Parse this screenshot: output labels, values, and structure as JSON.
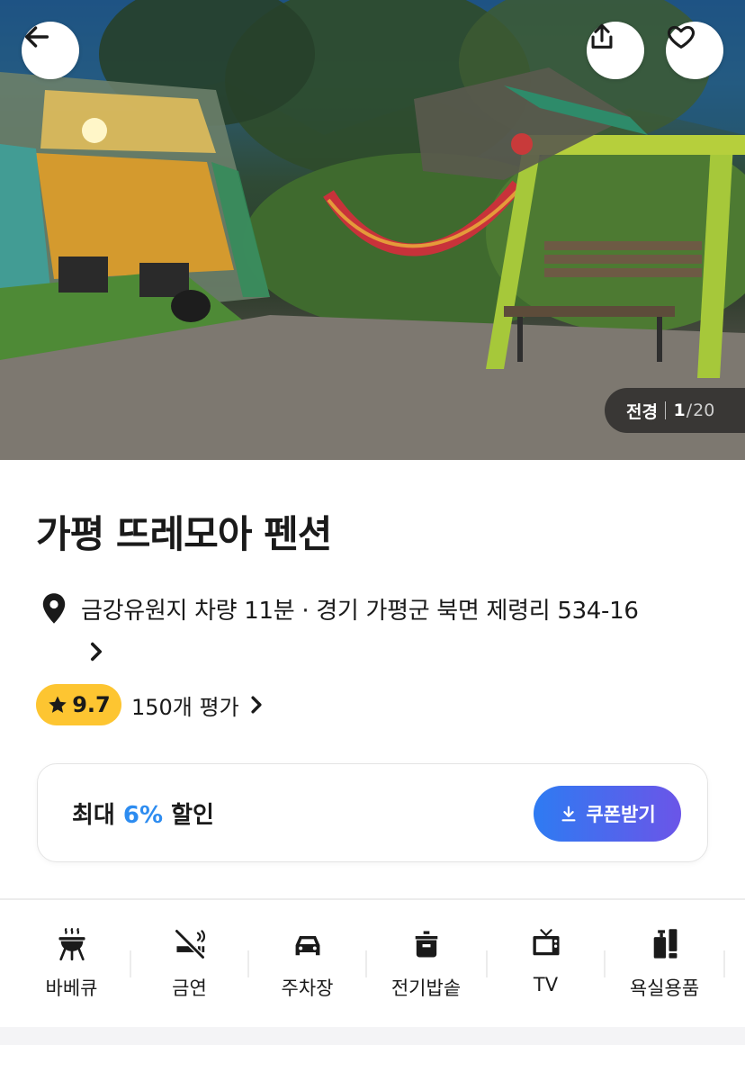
{
  "hero": {
    "photo_category": "전경",
    "photo_current": "1",
    "photo_total": "20"
  },
  "listing": {
    "title": "가평 뜨레모아 펜션",
    "location": "금강유원지 차량 11분 · 경기 가평군 북면 제령리 534-16",
    "rating": "9.7",
    "review_count": "150개 평가"
  },
  "coupon": {
    "prefix": "최대 ",
    "discount": "6%",
    "suffix": " 할인",
    "button_label": "쿠폰받기"
  },
  "amenities": [
    {
      "label": "바베큐",
      "icon": "barbecue-grill-icon"
    },
    {
      "label": "금연",
      "icon": "no-smoking-icon"
    },
    {
      "label": "주차장",
      "icon": "car-parking-icon"
    },
    {
      "label": "전기밥솥",
      "icon": "rice-cooker-icon"
    },
    {
      "label": "TV",
      "icon": "tv-icon"
    },
    {
      "label": "욕실용품",
      "icon": "bath-amenities-icon"
    }
  ],
  "colors": {
    "rating_badge": "#fdc531",
    "discount_accent": "#2d8cf0",
    "coupon_gradient_start": "#2e7bf2",
    "coupon_gradient_end": "#6b55e8"
  }
}
